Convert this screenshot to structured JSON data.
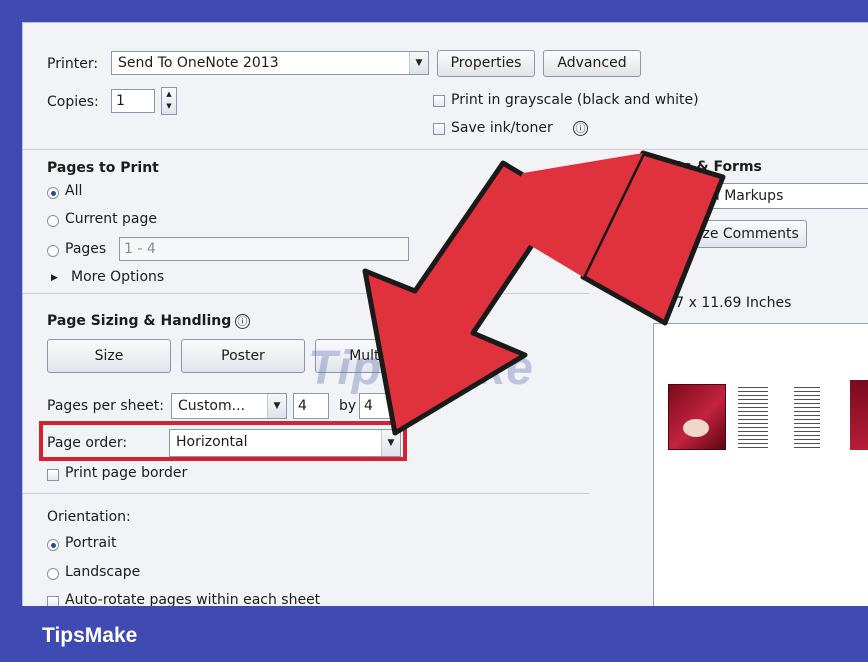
{
  "printer": {
    "label": "Printer:",
    "value": "Send To OneNote 2013",
    "properties_button": "Properties",
    "advanced_button": "Advanced"
  },
  "copies": {
    "label": "Copies:",
    "value": "1"
  },
  "options": {
    "grayscale_label": "Print in grayscale (black and white)",
    "save_ink_label": "Save ink/toner",
    "info_glyph": "ⓘ"
  },
  "pages_to_print": {
    "heading": "Pages to Print",
    "all": "All",
    "current_page": "Current page",
    "pages": "Pages",
    "pages_range": "1 - 4",
    "more_options": "More Options"
  },
  "comments_forms": {
    "heading": "ents & Forms",
    "value": "ent and Markups",
    "summarize_button": "Summarize Comments"
  },
  "page_size_text": "8.27 x 11.69 Inches",
  "page_sizing": {
    "heading": "Page Sizing & Handling",
    "size_button": "Size",
    "poster_button": "Poster",
    "multiple_button": "Multiple",
    "pages_per_sheet_label": "Pages per sheet:",
    "pages_per_sheet_value": "Custom...",
    "cols": "4",
    "by_label": "by",
    "rows": "4",
    "page_order_label": "Page order:",
    "page_order_value": "Horizontal",
    "print_border_label": "Print page border"
  },
  "orientation": {
    "heading": "Orientation:",
    "portrait": "Portrait",
    "landscape": "Landscape",
    "auto_rotate": "Auto-rotate pages within each sheet"
  },
  "watermark": "TipsMake",
  "brand": "TipsMake",
  "colors": {
    "frame": "#3f4bb2",
    "highlight": "#d32232",
    "arrow_fill": "#e0323c",
    "arrow_stroke": "#1a1a1a"
  }
}
